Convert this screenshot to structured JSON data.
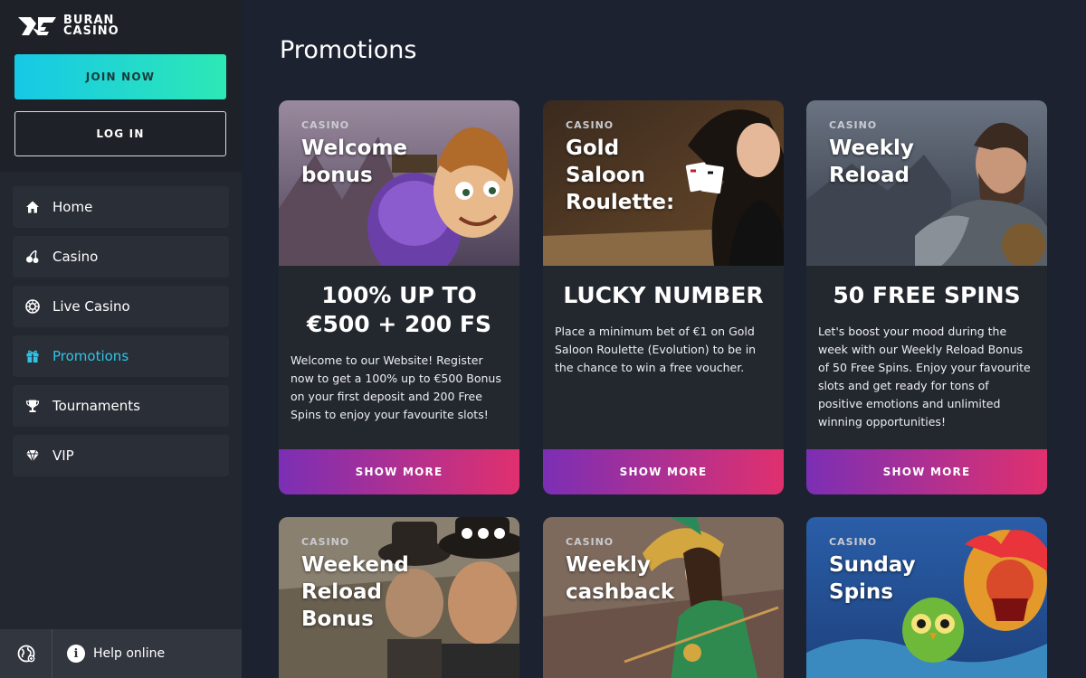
{
  "brand": {
    "line1": "BURAN",
    "line2": "CASINO"
  },
  "auth": {
    "join_label": "JOIN NOW",
    "login_label": "LOG IN"
  },
  "nav": [
    {
      "label": "Home",
      "icon": "home-icon"
    },
    {
      "label": "Casino",
      "icon": "cherries-icon"
    },
    {
      "label": "Live Casino",
      "icon": "roulette-icon"
    },
    {
      "label": "Promotions",
      "icon": "gift-icon",
      "active": true
    },
    {
      "label": "Tournaments",
      "icon": "trophy-icon"
    },
    {
      "label": "VIP",
      "icon": "diamond-icon"
    }
  ],
  "footer": {
    "help_label": "Help online",
    "help_icon": "info-icon",
    "lang_icon": "globe-icon"
  },
  "page": {
    "title": "Promotions"
  },
  "colors": {
    "accent": "#2fc4e8",
    "join_from": "#17c8e6",
    "join_to": "#2de8b5",
    "btn_from": "#7b2fb5",
    "btn_to": "#e0306e",
    "bg": "#1c2230"
  },
  "promotions": [
    {
      "category": "CASINO",
      "title": "Welcome\nbonus",
      "headline": "100% UP TO €500 + 200 FS",
      "description": "Welcome to our Website! Register now to get a 100% up to €500 Bonus on your first deposit and 200 Free Spins to enjoy your favourite slots!",
      "button": "SHOW MORE"
    },
    {
      "category": "CASINO",
      "title": "Gold\nSaloon\nRoulette:",
      "headline": "LUCKY NUMBER",
      "description": "Place a minimum bet of €1 on Gold Saloon Roulette (Evolution) to be in the chance to win a free voucher.",
      "button": "SHOW MORE"
    },
    {
      "category": "CASINO",
      "title": "Weekly\nReload",
      "headline": "50 FREE SPINS",
      "description": "Let's boost your mood during the week with our Weekly Reload Bonus of 50 Free Spins. Enjoy your favourite slots and get ready for tons of positive emotions and unlimited winning opportunities!",
      "button": "SHOW MORE"
    },
    {
      "category": "CASINO",
      "title": "Weekend\nReload\nBonus"
    },
    {
      "category": "CASINO",
      "title": "Weekly\ncashback"
    },
    {
      "category": "CASINO",
      "title": "Sunday\nSpins"
    }
  ]
}
